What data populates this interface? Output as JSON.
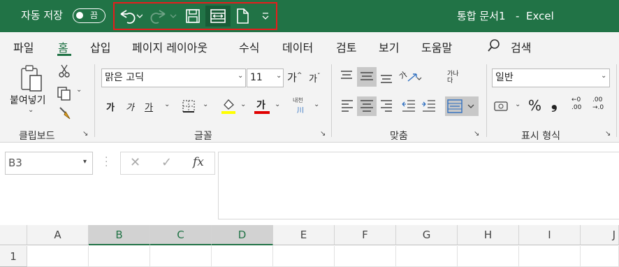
{
  "titlebar": {
    "autosave_label": "자동 저장",
    "autosave_state": "끔",
    "doc_title": "통합 문서1",
    "separator": "-",
    "app_name": "Excel"
  },
  "tabs": [
    "파일",
    "홈",
    "삽입",
    "페이지 레이아웃",
    "수식",
    "데이터",
    "검토",
    "보기",
    "도움말"
  ],
  "search_label": "검색",
  "ribbon": {
    "clipboard": {
      "paste_label": "붙여넣기",
      "group_label": "클립보드"
    },
    "font": {
      "font_name": "맑은 고딕",
      "font_size": "11",
      "grow_glyph": "가",
      "shrink_glyph": "가",
      "bold": "가",
      "italic": "가",
      "underline": "가",
      "color_glyph": "가",
      "phonetic_top": "내천",
      "group_label": "글꼴"
    },
    "alignment": {
      "orient_glyph": "가",
      "wrap_top": "가나",
      "wrap_bottom": "다",
      "group_label": "맞춤"
    },
    "number": {
      "format": "일반",
      "percent": "%",
      "comma": "❟",
      "inc_decimal_top": "←0",
      "inc_decimal_bottom": ".00",
      "dec_decimal_top": ".00",
      "dec_decimal_bottom": "→.0",
      "group_label": "표시 형식"
    }
  },
  "formula_bar": {
    "name_box": "B3",
    "fx": "fx"
  },
  "grid": {
    "columns": [
      "A",
      "B",
      "C",
      "D",
      "E",
      "F",
      "G",
      "H",
      "I",
      "J"
    ],
    "selected_columns": [
      "B",
      "C",
      "D"
    ],
    "rows": [
      "1"
    ]
  },
  "colors": {
    "excel_green": "#217346",
    "highlight_yellow": "#ffff00",
    "font_red": "#e00000",
    "annotation_red": "#e81c1c"
  }
}
